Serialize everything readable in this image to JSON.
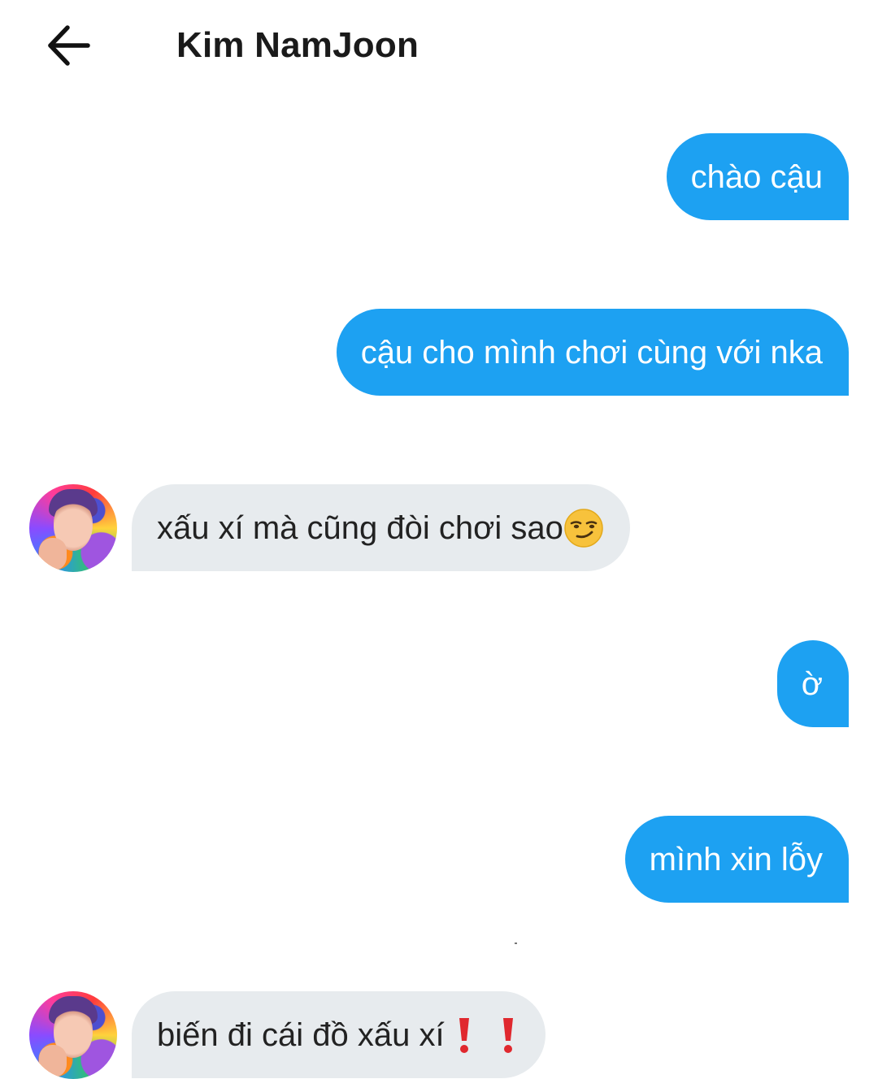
{
  "header": {
    "back_icon": "arrow-left-icon",
    "contact_name": "Kim NamJoon"
  },
  "colors": {
    "sent_bubble": "#1da1f2",
    "received_bubble": "#e7ebee",
    "sent_text": "#ffffff",
    "received_text": "#222222"
  },
  "messages": [
    {
      "direction": "sent",
      "text": "chào cậu"
    },
    {
      "direction": "sent",
      "text": "cậu cho mình chơi cùng với nka"
    },
    {
      "direction": "received",
      "text": "xấu xí mà cũng đòi chơi sao",
      "emoji": "smirking-face"
    },
    {
      "direction": "sent",
      "text": "ờ"
    },
    {
      "direction": "sent",
      "text": "mình xin lỗy"
    },
    {
      "direction": "received",
      "text": "biến đi cái đồ xấu xí",
      "emoji": "double-red-exclamation"
    }
  ]
}
